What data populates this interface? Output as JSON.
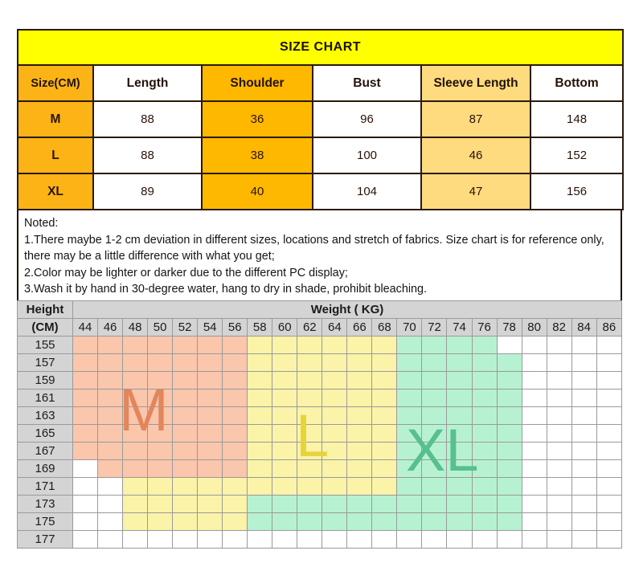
{
  "size_chart": {
    "title": "SIZE CHART",
    "columns": [
      {
        "label": "Size(CM)",
        "style": "sizecol"
      },
      {
        "label": "Length",
        "style": "plain"
      },
      {
        "label": "Shoulder",
        "style": "strong"
      },
      {
        "label": "Bust",
        "style": "plain"
      },
      {
        "label": "Sleeve Length",
        "style": "soft"
      },
      {
        "label": "Bottom",
        "style": "plain"
      }
    ],
    "rows": [
      {
        "size": "M",
        "length": "88",
        "shoulder": "36",
        "bust": "96",
        "sleeve": "87",
        "bottom": "148"
      },
      {
        "size": "L",
        "length": "88",
        "shoulder": "38",
        "bust": "100",
        "sleeve": "46",
        "bottom": "152"
      },
      {
        "size": "XL",
        "length": "89",
        "shoulder": "40",
        "bust": "104",
        "sleeve": "47",
        "bottom": "156"
      }
    ]
  },
  "notes": {
    "heading": "Noted:",
    "line1": "1.There maybe 1-2 cm deviation in different sizes, locations and stretch of fabrics. Size chart is for reference only, there may be a little difference with what you get;",
    "line2": "2.Color may be lighter or darker due to the different PC display;",
    "line3": "3.Wash it by hand in 30-degree water, hang to dry in shade, prohibit bleaching."
  },
  "colors": {
    "title_bg": "#FFFF00",
    "accent_strong": "#FFB800",
    "accent_soft": "#FDDB7E",
    "size_col": "#FBB316",
    "zone_m": "#FAC6AC",
    "zone_l": "#FAF3A8",
    "zone_xl": "#B6F2D2",
    "grid_header": "#D4D4D4"
  },
  "chart_data": {
    "type": "heatmap",
    "title": "Height / Weight size recommendation grid",
    "xlabel": "Weight ( KG)",
    "ylabel": "Height (CM)",
    "legend": [
      "M",
      "L",
      "XL"
    ],
    "legend_position": "in-plot watermark labels",
    "grid": true,
    "x": [
      44,
      46,
      48,
      50,
      52,
      54,
      56,
      58,
      60,
      62,
      64,
      66,
      68,
      70,
      72,
      74,
      76,
      78,
      80,
      82,
      84,
      86
    ],
    "y": [
      155,
      157,
      159,
      161,
      163,
      165,
      167,
      169,
      171,
      173,
      175,
      177
    ],
    "zone_codes": {
      "0": "none",
      "1": "M",
      "2": "L",
      "3": "XL"
    },
    "values": [
      [
        1,
        1,
        1,
        1,
        1,
        1,
        1,
        2,
        2,
        2,
        2,
        2,
        2,
        3,
        3,
        3,
        3,
        0,
        0,
        0,
        0,
        0
      ],
      [
        1,
        1,
        1,
        1,
        1,
        1,
        1,
        2,
        2,
        2,
        2,
        2,
        2,
        3,
        3,
        3,
        3,
        3,
        0,
        0,
        0,
        0
      ],
      [
        1,
        1,
        1,
        1,
        1,
        1,
        1,
        2,
        2,
        2,
        2,
        2,
        2,
        3,
        3,
        3,
        3,
        3,
        0,
        0,
        0,
        0
      ],
      [
        1,
        1,
        1,
        1,
        1,
        1,
        1,
        2,
        2,
        2,
        2,
        2,
        2,
        3,
        3,
        3,
        3,
        3,
        0,
        0,
        0,
        0
      ],
      [
        1,
        1,
        1,
        1,
        1,
        1,
        1,
        2,
        2,
        2,
        2,
        2,
        2,
        3,
        3,
        3,
        3,
        3,
        0,
        0,
        0,
        0
      ],
      [
        1,
        1,
        1,
        1,
        1,
        1,
        1,
        2,
        2,
        2,
        2,
        2,
        2,
        3,
        3,
        3,
        3,
        3,
        0,
        0,
        0,
        0
      ],
      [
        1,
        1,
        1,
        1,
        1,
        1,
        1,
        2,
        2,
        2,
        2,
        2,
        2,
        3,
        3,
        3,
        3,
        3,
        0,
        0,
        0,
        0
      ],
      [
        0,
        1,
        1,
        1,
        1,
        1,
        1,
        2,
        2,
        2,
        2,
        2,
        2,
        3,
        3,
        3,
        3,
        3,
        0,
        0,
        0,
        0
      ],
      [
        0,
        0,
        2,
        2,
        2,
        2,
        2,
        2,
        2,
        2,
        2,
        2,
        2,
        3,
        3,
        3,
        3,
        3,
        0,
        0,
        0,
        0
      ],
      [
        0,
        0,
        2,
        2,
        2,
        2,
        2,
        3,
        3,
        3,
        3,
        3,
        3,
        3,
        3,
        3,
        3,
        3,
        0,
        0,
        0,
        0
      ],
      [
        0,
        0,
        2,
        2,
        2,
        2,
        2,
        3,
        3,
        3,
        3,
        3,
        3,
        3,
        3,
        3,
        3,
        3,
        0,
        0,
        0,
        0
      ],
      [
        0,
        0,
        0,
        0,
        0,
        0,
        0,
        0,
        0,
        0,
        0,
        0,
        0,
        0,
        0,
        0,
        0,
        0,
        0,
        0,
        0,
        0
      ]
    ],
    "watermarks": [
      {
        "label": "M",
        "color": "#E2865C"
      },
      {
        "label": "L",
        "color": "#E7D33C"
      },
      {
        "label": "XL",
        "color": "#57BF90"
      }
    ]
  }
}
